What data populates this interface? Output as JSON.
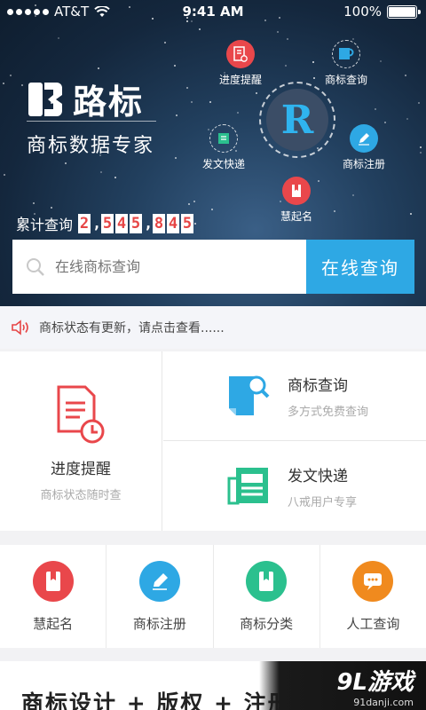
{
  "status_bar": {
    "carrier": "AT&T",
    "time": "9:41 AM",
    "battery": "100%"
  },
  "brand": {
    "name": "路标",
    "slogan": "商标数据专家",
    "center_letter": "R"
  },
  "orbit_nodes": [
    {
      "label": "进度提醒",
      "color": "#e9474b",
      "icon": "document-clock-icon"
    },
    {
      "label": "商标查询",
      "color": "#2ea8e4",
      "icon": "document-search-icon"
    },
    {
      "label": "商标注册",
      "color": "#2ea8e4",
      "icon": "pen-icon"
    },
    {
      "label": "发文快递",
      "color": "#2bc08e",
      "icon": "newspaper-icon"
    },
    {
      "label": "慧起名",
      "color": "#e9474b",
      "icon": "book-icon"
    }
  ],
  "counter": {
    "label": "累计查询",
    "digits": [
      "2",
      ",",
      "5",
      "4",
      "5",
      ",",
      "8",
      "4",
      "5"
    ]
  },
  "search": {
    "placeholder": "在线商标查询",
    "button": "在线查询"
  },
  "notice": {
    "text": "商标状态有更新，请点击查看......"
  },
  "panel": {
    "left": {
      "title": "进度提醒",
      "subtitle": "商标状态随时查"
    },
    "right_top": {
      "title": "商标查询",
      "subtitle": "多方式免费查询"
    },
    "right_bottom": {
      "title": "发文快递",
      "subtitle": "八戒用户专享"
    }
  },
  "grid": [
    {
      "label": "慧起名",
      "color": "#e9474b",
      "icon": "book-icon"
    },
    {
      "label": "商标注册",
      "color": "#2ea8e4",
      "icon": "pen-icon"
    },
    {
      "label": "商标分类",
      "color": "#2bc08e",
      "icon": "book-icon"
    },
    {
      "label": "人工查询",
      "color": "#f08a1e",
      "icon": "chat-icon"
    }
  ],
  "banner": {
    "text": "商标设计 + 版权 + 注册"
  },
  "watermark": {
    "line1": "9L游戏",
    "line2": "91danji.com"
  }
}
